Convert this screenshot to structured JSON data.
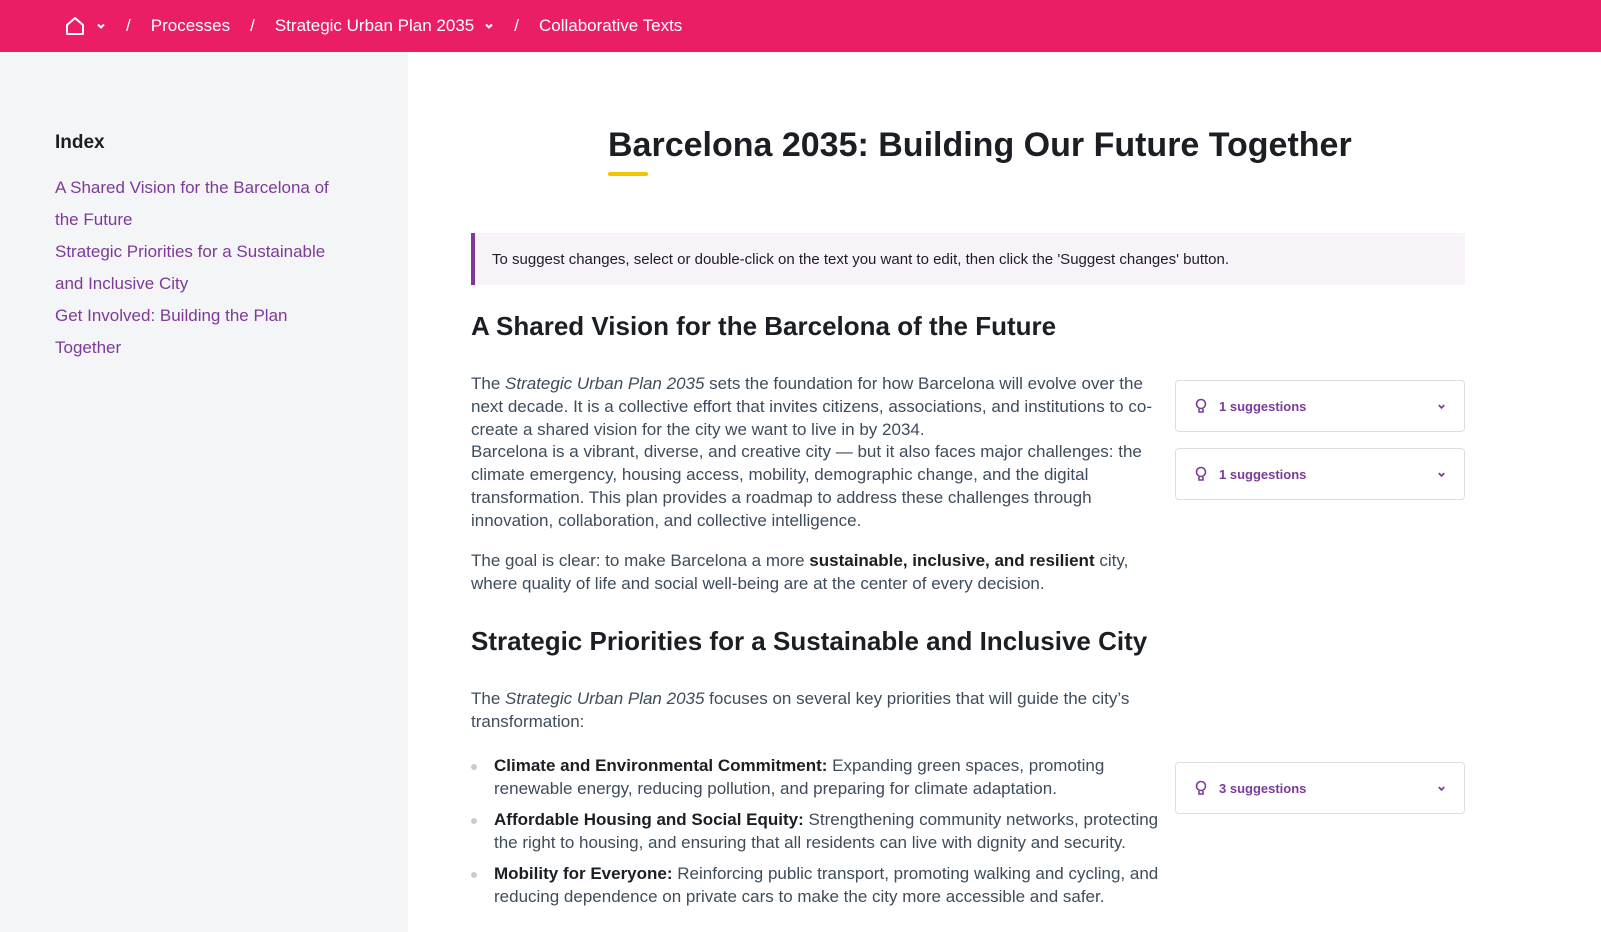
{
  "breadcrumb": {
    "home_icon": "home-icon",
    "dropdown_icon": "chevron-down-icon",
    "separator": "/",
    "items": [
      "Processes",
      "Strategic Urban Plan 2035",
      "Collaborative Texts"
    ]
  },
  "sidebar": {
    "heading": "Index",
    "links": [
      "A Shared Vision for the Barcelona of the Future",
      "Strategic Priorities for a Sustainable and Inclusive City",
      "Get Involved: Building the Plan Together"
    ]
  },
  "main": {
    "title": "Barcelona 2035: Building Our Future Together",
    "callout": "To suggest changes, select or double-click on the text you want to edit, then click the 'Suggest changes' button.",
    "section1": {
      "heading": "A Shared Vision for the Barcelona of the Future",
      "p1": {
        "pre": "The ",
        "em": "Strategic Urban Plan 2035",
        "post": " sets the foundation for how Barcelona will evolve over the next decade. It is a collective effort that invites citizens, associations, and institutions to co-create a shared vision for the city we want to live in by 2034."
      },
      "p2": "Barcelona is a vibrant, diverse, and creative city — but it also faces major challenges: the climate emergency, housing access, mobility, demographic change, and the digital transformation. This plan provides a roadmap to address these challenges through innovation, collaboration, and collective intelligence.",
      "p3": {
        "pre": "The goal is clear: to make Barcelona a more ",
        "strong": "sustainable, inclusive, and resilient",
        "post": " city, where quality of life and social well-being are at the center of every decision."
      }
    },
    "section2": {
      "heading": "Strategic Priorities for a Sustainable and Inclusive City",
      "intro": {
        "pre": "The ",
        "em": "Strategic Urban Plan 2035",
        "post": " focuses on several key priorities that will guide the city’s transformation:"
      },
      "list": [
        {
          "label": "Climate and Environmental Commitment:",
          "text": " Expanding green spaces, promoting renewable energy, reducing pollution, and preparing for climate adaptation."
        },
        {
          "label": "Affordable Housing and Social Equity:",
          "text": " Strengthening community networks, protecting the right to housing, and ensuring that all residents can live with dignity and security."
        },
        {
          "label": "Mobility for Everyone:",
          "text": " Reinforcing public transport, promoting walking and cycling, and reducing dependence on private cars to make the city more accessible and safer."
        }
      ]
    },
    "suggestions": [
      {
        "label": "1 suggestions",
        "icon": "lightbulb-icon"
      },
      {
        "label": "1 suggestions",
        "icon": "lightbulb-icon"
      },
      {
        "label": "3 suggestions",
        "icon": "lightbulb-icon"
      }
    ]
  },
  "colors": {
    "topbar": "#ea1d66",
    "accent": "#7d3a99",
    "underline": "#f3c400",
    "sidebar_bg": "#f4f5f7",
    "callout_bg": "#f7f3f9"
  }
}
